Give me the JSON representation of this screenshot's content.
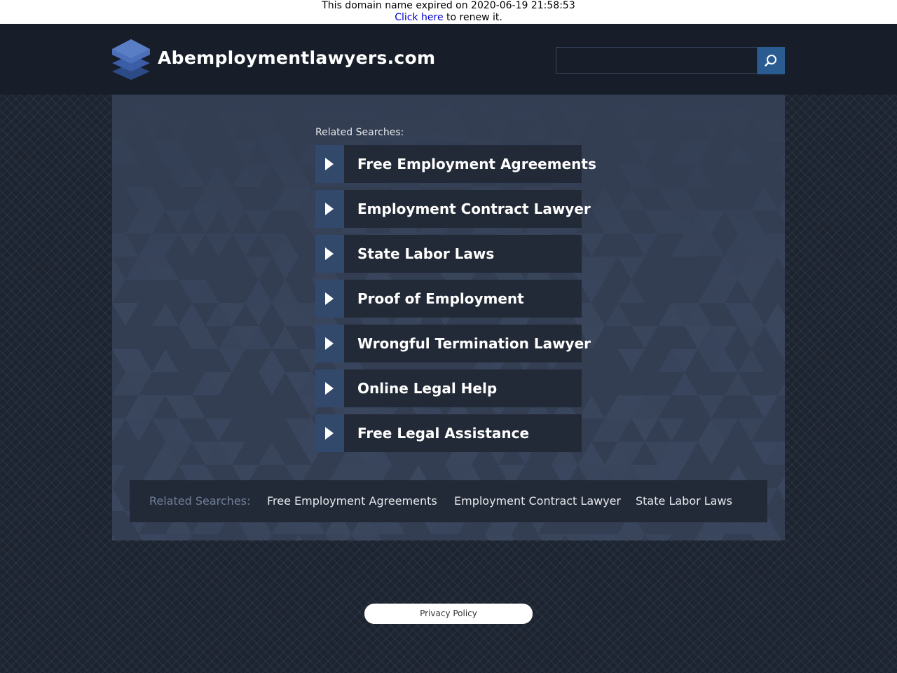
{
  "notice": {
    "expired_text": "This domain name expired on 2020-06-19 21:58:53",
    "click_here": "Click here",
    "renew_text": " to renew it."
  },
  "header": {
    "site_title": "Abemploymentlawyers.com",
    "logo_icon": "stacked-layers-icon",
    "search": {
      "placeholder": "",
      "button_icon": "search-icon"
    }
  },
  "main": {
    "related_label": "Related Searches:",
    "links": [
      "Free Employment Agreements",
      "Employment Contract Lawyer",
      "State Labor Laws",
      "Proof of Employment",
      "Wrongful Termination Lawyer",
      "Online Legal Help",
      "Free Legal Assistance"
    ]
  },
  "bottom_bar": {
    "label": "Related Searches:",
    "links": [
      "Free Employment Agreements",
      "Employment Contract Lawyer",
      "State Labor Laws"
    ]
  },
  "footer": {
    "privacy": "Privacy Policy"
  },
  "colors": {
    "header_bg": "#181e29",
    "panel_bg": "#333e53",
    "link_bg": "#232a37",
    "arrow_bg": "#33496b",
    "search_button": "#2a5c92",
    "link_blue": "#0000cc"
  }
}
